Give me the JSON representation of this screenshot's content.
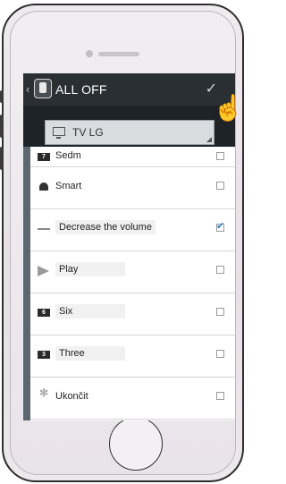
{
  "topbar": {
    "back": "‹",
    "title": "ALL OFF",
    "confirm": "✓"
  },
  "device": {
    "selected": "TV LG"
  },
  "rows": [
    {
      "icon_text": "7",
      "label": "Sedm",
      "checked": false
    },
    {
      "icon_text": "",
      "label": "Smart",
      "checked": false
    },
    {
      "icon_text": "",
      "label": "Decrease the volume",
      "checked": true
    },
    {
      "icon_text": "",
      "label": "Play",
      "checked": false
    },
    {
      "icon_text": "6",
      "label": "Six",
      "checked": false
    },
    {
      "icon_text": "3",
      "label": "Three",
      "checked": false
    },
    {
      "icon_text": "",
      "label": "Ukončit",
      "checked": false
    }
  ],
  "hand_glyph": "☝"
}
